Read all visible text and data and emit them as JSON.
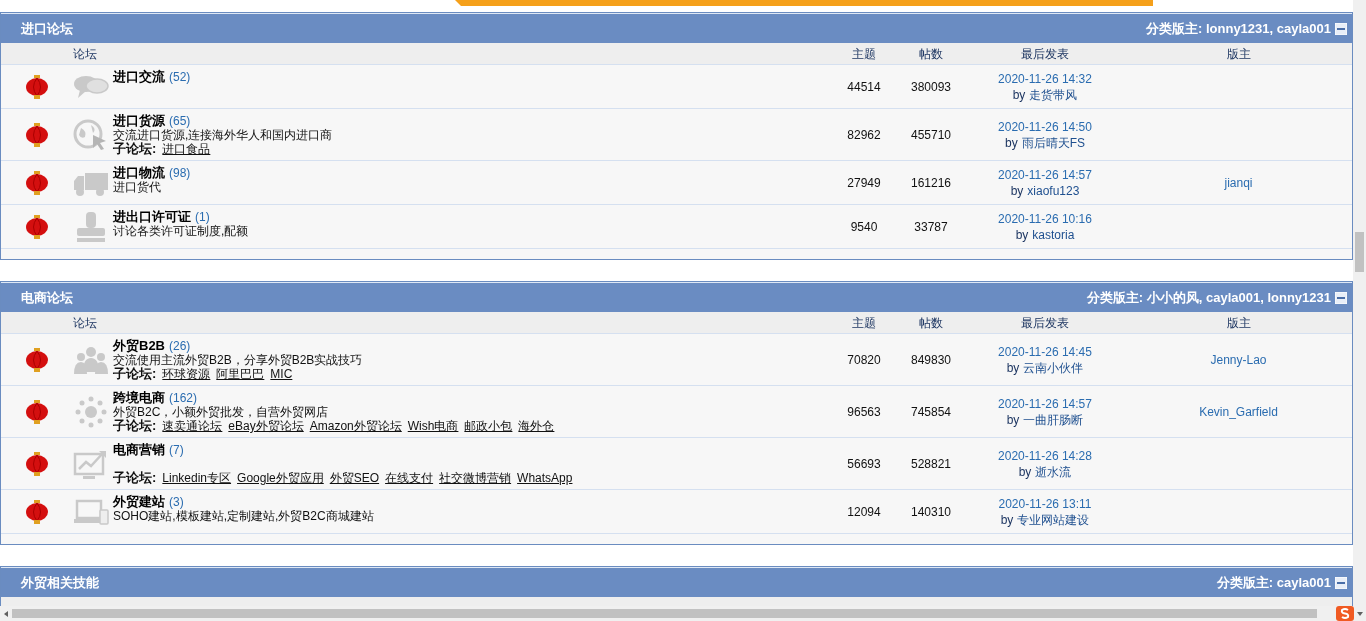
{
  "sections": [
    {
      "title": "进口论坛",
      "moderators": "分类版主: lonny1231, cayla001",
      "expanded": true,
      "columns": [
        "论坛",
        "主题",
        "帖数",
        "最后发表",
        "版主"
      ],
      "forums": [
        {
          "title": "进口交流",
          "count": "(52)",
          "topics": "44514",
          "posts": "380093",
          "last_post": {
            "time": "2020-11-26 14:32",
            "by": "by",
            "author": "走货带风"
          }
        },
        {
          "title": "进口货源",
          "count": "(65)",
          "description": "交流进口货源,连接海外华人和国内进口商",
          "subforums": {
            "label": "子论坛:",
            "links": [
              "进口食品"
            ]
          },
          "topics": "82962",
          "posts": "455710",
          "last_post": {
            "time": "2020-11-26 14:50",
            "by": "by",
            "author": "雨后晴天FS"
          }
        },
        {
          "title": "进口物流",
          "count": "(98)",
          "description": "进口货代",
          "topics": "27949",
          "posts": "161216",
          "last_post": {
            "time": "2020-11-26 14:57",
            "by": "by",
            "author": "xiaofu123"
          },
          "moderator": "jianqi"
        },
        {
          "title": "进出口许可证",
          "count": "(1)",
          "description": "讨论各类许可证制度,配额",
          "topics": "9540",
          "posts": "33787",
          "last_post": {
            "time": "2020-11-26 10:16",
            "by": "by",
            "author": "kastoria"
          }
        }
      ]
    },
    {
      "title": "电商论坛",
      "moderators": "分类版主: 小小的风, cayla001, lonny1231",
      "expanded": true,
      "columns": [
        "论坛",
        "主题",
        "帖数",
        "最后发表",
        "版主"
      ],
      "forums": [
        {
          "title": "外贸B2B",
          "count": "(26)",
          "description": "交流使用主流外贸B2B，分享外贸B2B实战技巧",
          "subforums": {
            "label": "子论坛:",
            "links": [
              "环球资源",
              "阿里巴巴",
              "MIC"
            ]
          },
          "topics": "70820",
          "posts": "849830",
          "last_post": {
            "time": "2020-11-26 14:45",
            "by": "by",
            "author": "云南小伙伴"
          },
          "moderator": "Jenny-Lao"
        },
        {
          "title": "跨境电商",
          "count": "(162)",
          "description": "外贸B2C，小额外贸批发，自营外贸网店",
          "subforums": {
            "label": "子论坛:",
            "links": [
              "速卖通论坛",
              "eBay外贸论坛",
              "Amazon外贸论坛",
              "Wish电商",
              "邮政小包",
              "海外仓"
            ]
          },
          "topics": "96563",
          "posts": "745854",
          "last_post": {
            "time": "2020-11-26 14:57",
            "by": "by",
            "author": "一曲肝肠断"
          },
          "moderator": "Kevin_Garfield"
        },
        {
          "title": "电商营销",
          "count": "(7)",
          "subforums": {
            "label": "子论坛:",
            "links": [
              "Linkedin专区",
              "Google外贸应用",
              "外贸SEO",
              "在线支付",
              "社交微博营销",
              "WhatsApp"
            ]
          },
          "topics": "56693",
          "posts": "528821",
          "last_post": {
            "time": "2020-11-26 14:28",
            "by": "by",
            "author": "逝水流"
          }
        },
        {
          "title": "外贸建站",
          "count": "(3)",
          "description": "SOHO建站,模板建站,定制建站,外贸B2C商城建站",
          "topics": "12094",
          "posts": "140310",
          "last_post": {
            "time": "2020-11-26 13:11",
            "by": "by",
            "author": "专业网站建设"
          }
        }
      ]
    },
    {
      "title": "外贸相关技能",
      "moderators": "分类版主: cayla001",
      "expanded": true
    }
  ]
}
